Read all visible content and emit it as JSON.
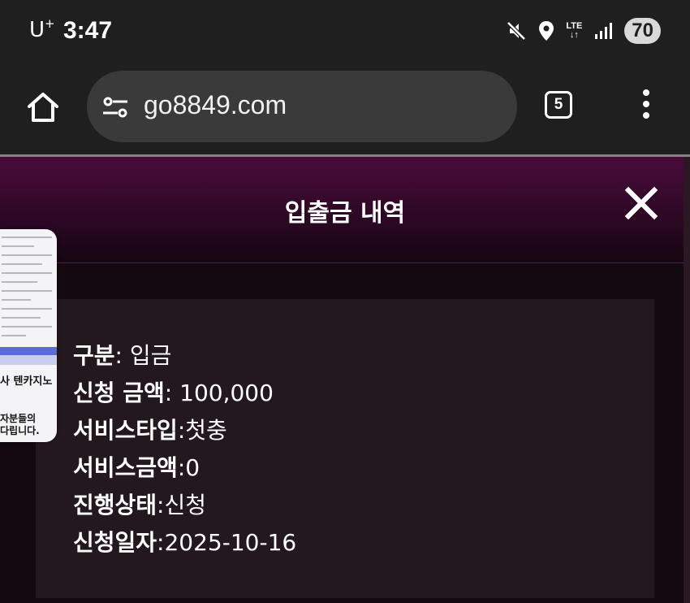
{
  "status_bar": {
    "carrier": "U",
    "carrier_sup": "+",
    "time": "3:47",
    "network": "LTE",
    "battery": "70"
  },
  "browser": {
    "url": "go8849.com",
    "tab_count": "5"
  },
  "modal": {
    "title": "입출금 내역"
  },
  "details": [
    {
      "label": "구분",
      "sep": ": ",
      "value": "입금"
    },
    {
      "label": "신청 금액",
      "sep": ": ",
      "value": "100,000"
    },
    {
      "label": "서비스타입",
      "sep": ":",
      "value": "첫충"
    },
    {
      "label": "서비스금액",
      "sep": ":",
      "value": "0"
    },
    {
      "label": "진행상태",
      "sep": ":",
      "value": "신청"
    },
    {
      "label": "신청일자",
      "sep": ":",
      "value": "2025-10-16"
    }
  ],
  "thumbnail": {
    "line1": "사 텐카지노",
    "line2": "자분들의",
    "line3": "다립니다."
  }
}
